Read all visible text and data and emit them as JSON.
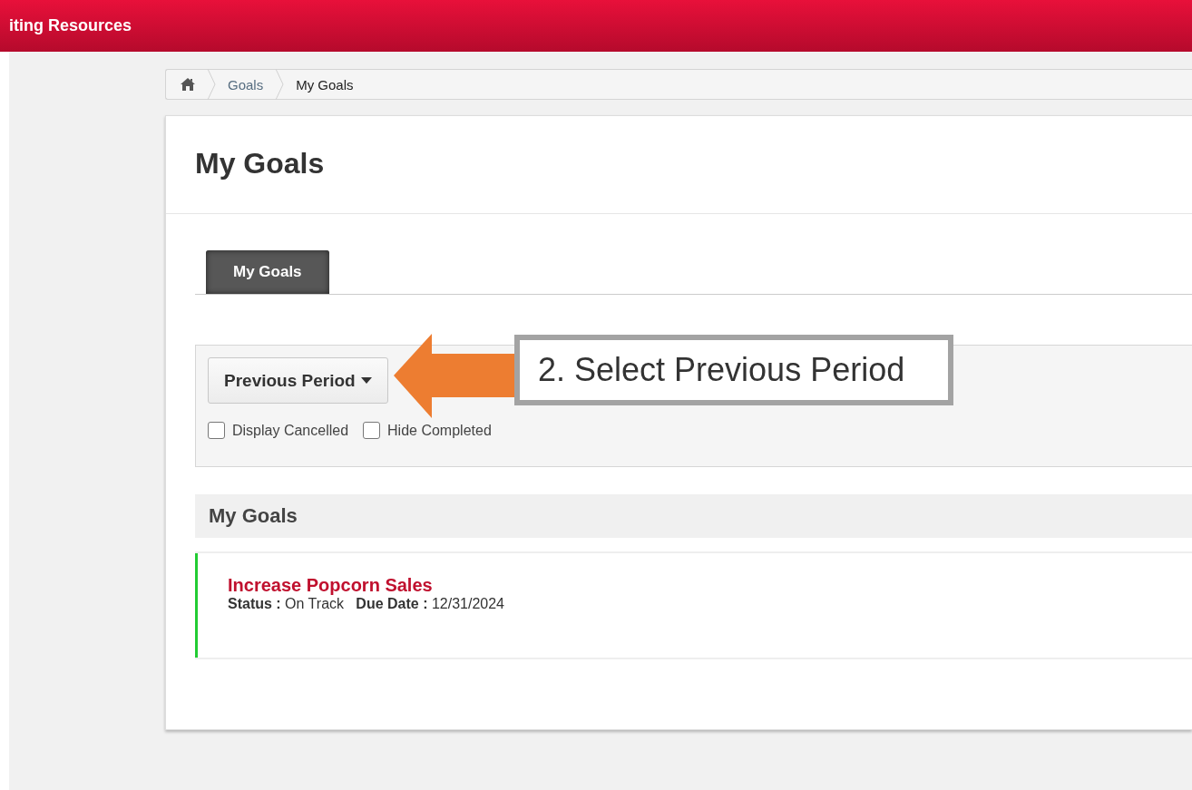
{
  "header": {
    "title": "iting Resources"
  },
  "breadcrumb": [
    {
      "kind": "home"
    },
    {
      "kind": "link",
      "label": "Goals"
    },
    {
      "kind": "current",
      "label": "My Goals"
    }
  ],
  "page_title": "My Goals",
  "tabs": [
    {
      "label": "My Goals",
      "selected": true
    }
  ],
  "filters": {
    "period_button": "Previous Period",
    "checkboxes": [
      {
        "label": "Display Cancelled",
        "checked": false
      },
      {
        "label": "Hide Completed",
        "checked": false
      }
    ]
  },
  "section_title": "My Goals",
  "goals": [
    {
      "title": "Increase Popcorn Sales",
      "status_label": "Status :",
      "status": "On Track",
      "due_label": "Due Date :",
      "due": "12/31/2024",
      "color": "#22cc33"
    }
  ],
  "annotation": {
    "text": "2. Select Previous Period"
  }
}
